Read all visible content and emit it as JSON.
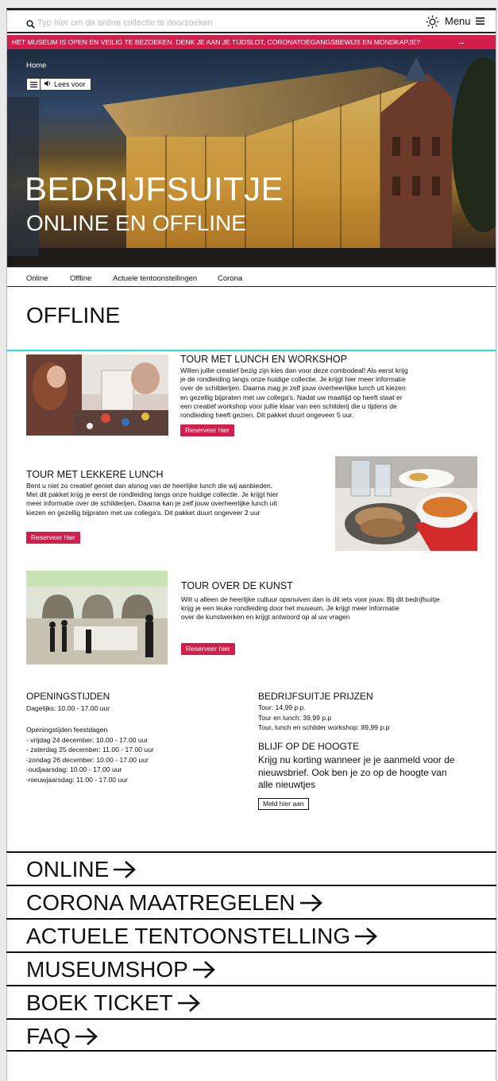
{
  "header": {
    "search_placeholder": "Typ hier om de online collectie te doorzoeken",
    "menu_label": "Menu",
    "icons": {
      "search": "search-icon",
      "theme": "sun-icon",
      "menu": "hamburger-icon"
    }
  },
  "alert": {
    "text": "HET MUSEUM IS OPEN EN VEILIG TE BEZOEKEN. DENK JE AAN JE TIJDSLOT, CORONATOEGANGSBEWIJS EN MONDKAPJE?",
    "color": "#d31e4c"
  },
  "hero": {
    "breadcrumb": "Home",
    "read_aloud": "Lees voor",
    "title": "BEDRIJFSUITJE",
    "subtitle": "ONLINE EN OFFLINE"
  },
  "subnav": [
    "Online",
    "Offline",
    "Actuele tentoonstellingen",
    "Corona"
  ],
  "section": {
    "title": "OFFLINE"
  },
  "tours": [
    {
      "title": "TOUR MET LUNCH EN WORKSHOP",
      "lines": [
        "Willen jullie creatief  bezig zijn kies dan voor deze combodeal! Als eerst krijg",
        "je de rondleiding langs onze huidige collectie. Je krijgt hier meer informatie",
        "over de schilderijen. Daarna mag je zelf jouw overheerlijke lunch uit kiezen",
        "en gezellig bijpraten met uw collega's. Nadat uw maaltijd op heeft staat er",
        "een creatief workshop voor jullie klaar van een schilderij die u tijdens de",
        "rondleiding heeft gezien. Dit pakket duurt ongeveer 5 uur."
      ],
      "button": "Reserveer hier"
    },
    {
      "title": "TOUR MET LEKKERE LUNCH",
      "lines": [
        "Bent u niet zo creatief geniet dan alsnog van de heerlijke lunch die wij aanbieden.",
        "Met dit pakket krijg je eerst de rondleiding langs onze huidige collectie. Je krijgt hier",
        "meer informatie over de schilderijen. Daarna kan je zelf jouw overheerlijke lunch uit",
        "kiezen en gezellig bijpraten met uw collega's. Dit pakket duurt ongeveer 2 uur"
      ],
      "button": "Reserveer hier"
    },
    {
      "title": "TOUR OVER DE KUNST",
      "lines": [
        "Wilt u alleen de heerlijke cultuur opsnuiven dan is dit iets voor jouw. Bij dit bedrijfsuitje",
        "krijg je een leuke rondleiding door het museum. Je krijgt meer informatie",
        "over de kunstwerken en krijgt antwoord op al uw vragen"
      ],
      "button": "Reserveer hier"
    }
  ],
  "hours": {
    "title": "OPENINGSTIJDEN",
    "daily": "Dagelijks: 10.00 - 17.00 uur",
    "holiday_title": "Openingstijden feestdagen",
    "holidays": [
      "- vrijdag 24 december: 10.00 - 17.00 uur",
      "- zaterdag 25 december: 11.00 - 17.00 uur",
      "-zondag 26 december: 10.00 - 17.00 uur",
      "-oudjaarsdag: 10.00 - 17.00 uur",
      "-nieuwjaarsdag: 11.00 - 17.00 uur"
    ]
  },
  "prices": {
    "title": "BEDRIJFSUITJE PRIJZEN",
    "lines": [
      "Tour:  14,99 p.p.",
      "Tour en lunch:   39,99 p.p",
      "Tour, lunch en schilder workshop: 89,99 p.p"
    ]
  },
  "newsletter": {
    "title": "BLIJF OP DE HOOGTE",
    "lines": [
      "Krijg nu korting wanneer je je aanmeld voor de",
      "nieuwsbrief. Ook ben je zo op de hoogte van",
      "alle nieuwtjes"
    ],
    "button": "Meld hier aan"
  },
  "bottom_links": [
    "ONLINE",
    "CORONA MAATREGELEN",
    "ACTUELE TENTOONSTELLING",
    "MUSEUMSHOP",
    "BOEK TICKET",
    "FAQ"
  ]
}
